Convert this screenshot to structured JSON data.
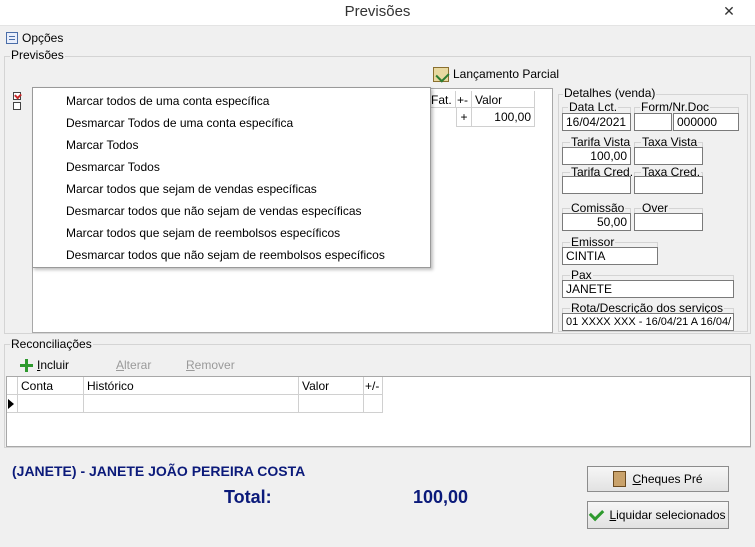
{
  "window": {
    "title": "Previsões",
    "close_glyph": "✕"
  },
  "menu": {
    "opcoes": "Opções"
  },
  "previsoes": {
    "label": "Previsões",
    "lancamento_parcial": "Lançamento Parcial",
    "columns": [
      "Fat.",
      "+-",
      "Valor"
    ],
    "row": {
      "sign": "+",
      "valor": "100,00"
    }
  },
  "context_menu": {
    "items": [
      "Marcar todos de uma conta específica",
      "Desmarcar Todos de uma conta específica",
      "Marcar Todos",
      "Desmarcar Todos",
      "Marcar todos que sejam de vendas específicas",
      "Desmarcar todos que não sejam de vendas específicas",
      "Marcar todos que sejam de reembolsos específicos",
      "Desmarcar todos que não sejam de reembolsos específicos"
    ]
  },
  "detalhes": {
    "label": "Detalhes (venda)",
    "data_lct": {
      "label": "Data Lct.",
      "value": "16/04/2021"
    },
    "form_nr_doc": {
      "label": "Form/Nr.Doc",
      "form": "",
      "doc": "000000"
    },
    "tarifa_vista": {
      "label": "Tarifa Vista",
      "value": "100,00"
    },
    "taxa_vista": {
      "label": "Taxa Vista",
      "value": ""
    },
    "tarifa_cred": {
      "label": "Tarifa Cred.",
      "value": ""
    },
    "taxa_cred": {
      "label": "Taxa Cred.",
      "value": ""
    },
    "comissao": {
      "label": "Comissão",
      "value": "50,00"
    },
    "over": {
      "label": "Over",
      "value": ""
    },
    "emissor": {
      "label": "Emissor",
      "value": "CINTIA"
    },
    "pax": {
      "label": "Pax",
      "value": "JANETE"
    },
    "rota": {
      "label": "Rota/Descrição dos serviços",
      "value": "01 XXXX XXX - 16/04/21 A 16/04/"
    }
  },
  "reconciliacoes": {
    "label": "Reconciliações",
    "incluir_first": "I",
    "incluir_rest": "ncluir",
    "alterar_first": "A",
    "alterar_rest": "lterar",
    "remover_first": "R",
    "remover_rest": "emover",
    "columns": [
      "Conta",
      "Histórico",
      "Valor",
      "+/-"
    ]
  },
  "footer": {
    "name": "(JANETE) - JANETE JOÃO PEREIRA COSTA",
    "total_label": "Total:",
    "total_value": "100,00",
    "cheques_first": "C",
    "cheques_rest": "heques Pré",
    "liquidar_first": "L",
    "liquidar_rest": "iquidar selecionados"
  },
  "icons": {
    "close": "close-icon",
    "menu": "menu-list-icon",
    "lancamento": "document-check-icon",
    "incluir": "plus-icon",
    "cheques": "cheque-icon",
    "liquidar": "checkmark-icon",
    "row_pointer": "row-pointer-icon"
  }
}
